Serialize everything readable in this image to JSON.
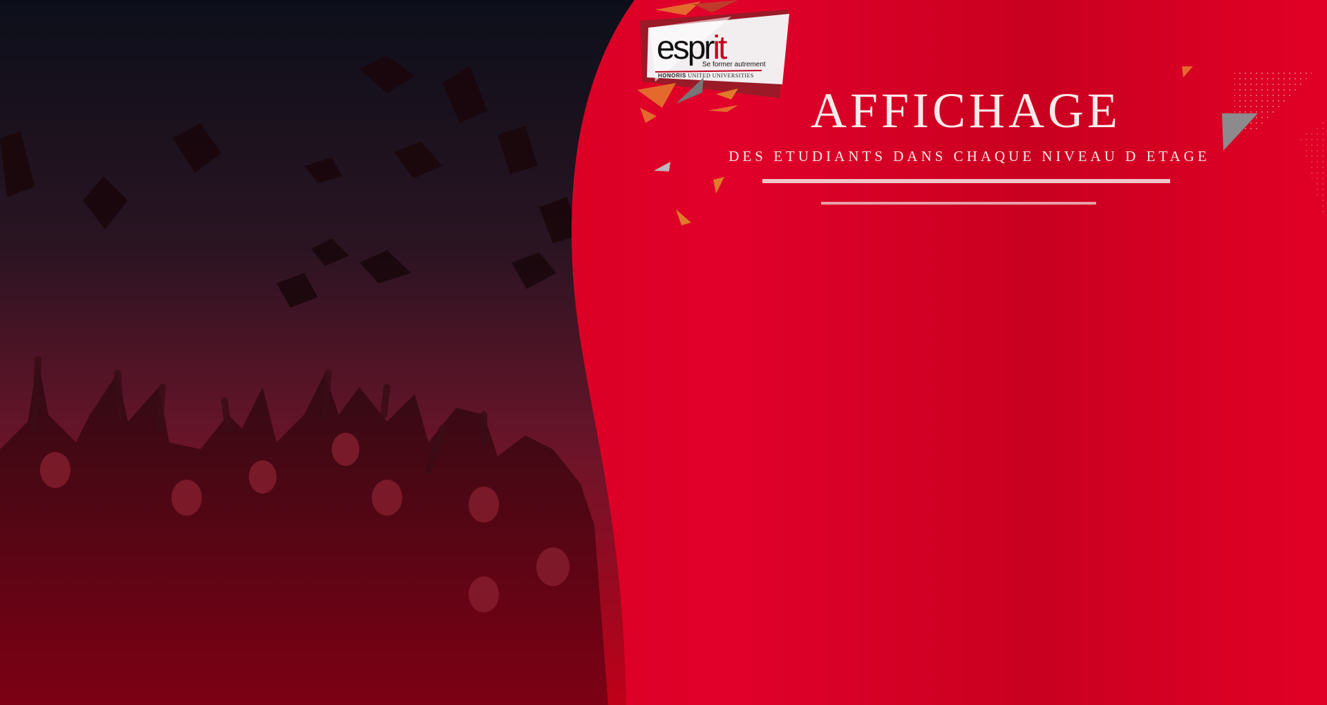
{
  "banner": {
    "title": "AFFICHAGE",
    "subtitle": "DES ETUDIANTS DANS CHAQUE NIVEAU D ETAGE"
  },
  "logo": {
    "wordmark_main": "espr",
    "wordmark_accent": "it",
    "tagline": "Se former autrement",
    "sub_bold": "HONORIS",
    "sub_rest": "UNITED UNIVERSITIES"
  },
  "colors": {
    "brand_red": "#e1002a",
    "deep_red": "#b4001c",
    "night": "#0c0f1a",
    "text_light": "#fbeaea"
  },
  "icons": [
    "graduation-cap-icon",
    "triangle-decoration-icon",
    "dot-grid-decoration-icon"
  ]
}
